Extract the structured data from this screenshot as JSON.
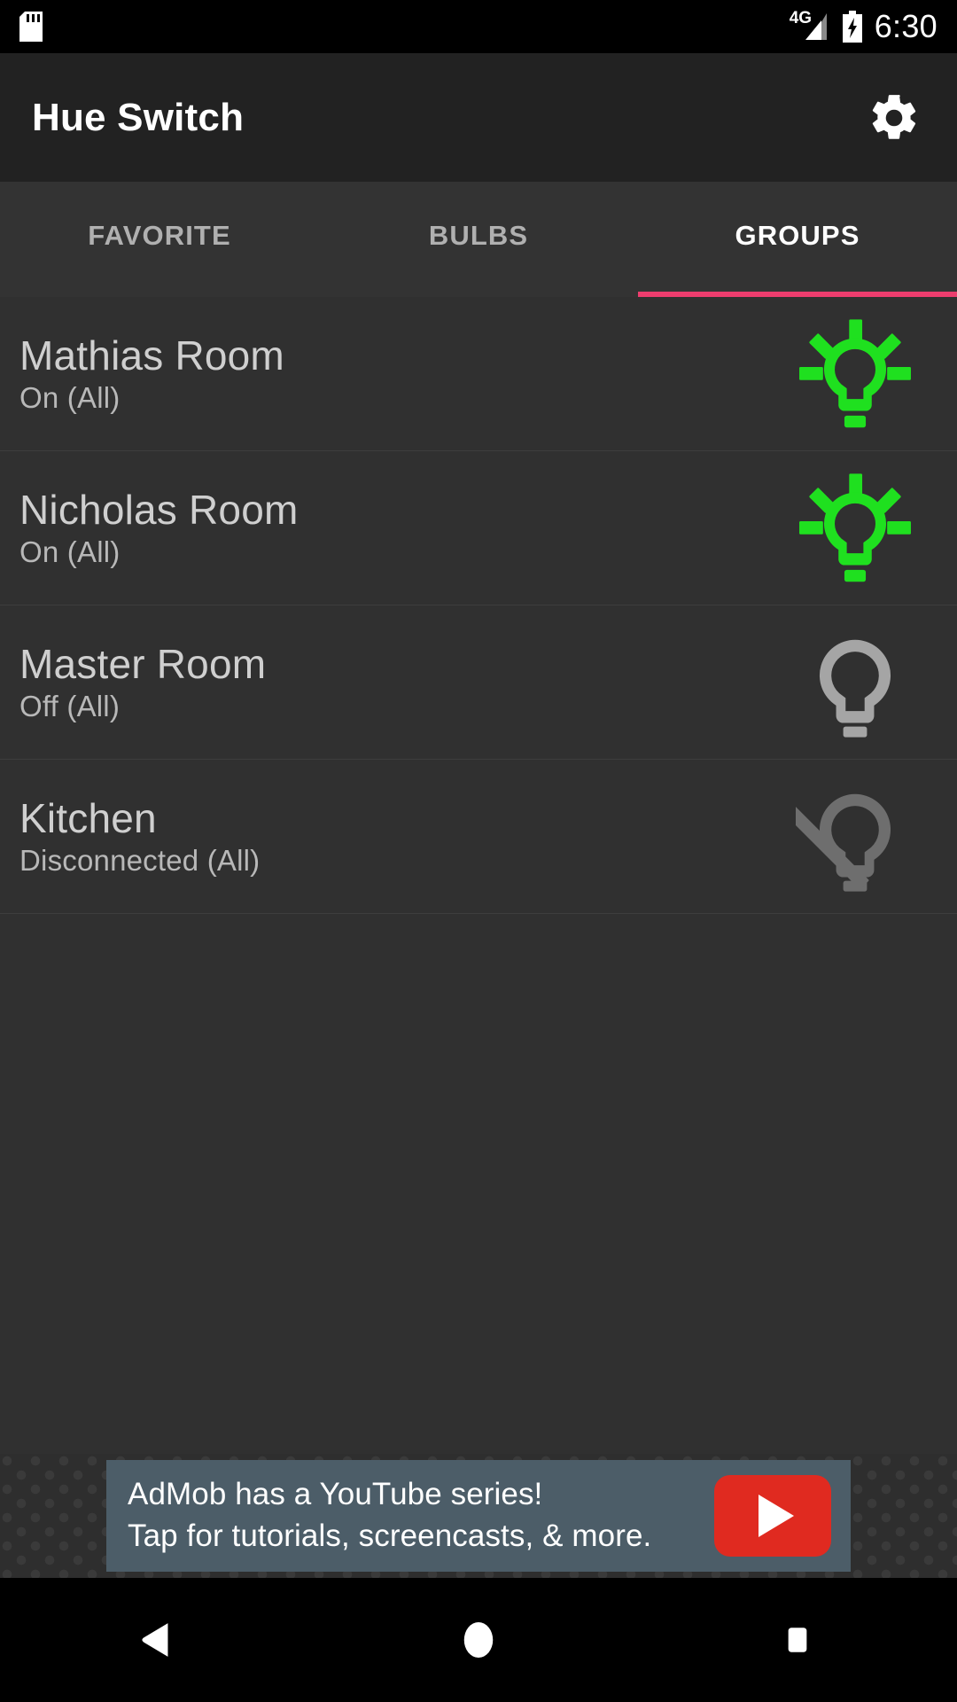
{
  "statusbar": {
    "sd_icon": "sd-card-icon",
    "network_label": "4G",
    "signal_icon": "signal-bars-icon",
    "battery_icon": "battery-charging-icon",
    "time": "6:30"
  },
  "toolbar": {
    "title": "Hue Switch",
    "settings_icon": "gear-icon"
  },
  "tabs": {
    "items": [
      {
        "label": "FAVORITE",
        "active": false
      },
      {
        "label": "BULBS",
        "active": false
      },
      {
        "label": "GROUPS",
        "active": true
      }
    ],
    "indicator_color": "#ED3D6E",
    "active_index": 2
  },
  "groups": {
    "rows": [
      {
        "name": "Mathias Room",
        "status": "On (All)",
        "icon": "bulb-on-icon",
        "icon_color": "#1FE01F"
      },
      {
        "name": "Nicholas Room",
        "status": "On (All)",
        "icon": "bulb-on-icon",
        "icon_color": "#1FE01F"
      },
      {
        "name": "Master Room",
        "status": "Off (All)",
        "icon": "bulb-off-icon",
        "icon_color": "#A5A5A5"
      },
      {
        "name": "Kitchen",
        "status": "Disconnected (All)",
        "icon": "bulb-disconnected-icon",
        "icon_color": "#6E6E6E"
      }
    ]
  },
  "ad": {
    "line1": "AdMob has a YouTube series!",
    "line2": "Tap for tutorials, screencasts, & more.",
    "play_icon": "youtube-play-icon",
    "background_color": "#4C5D68",
    "play_button_color": "#E02A20"
  },
  "navbar": {
    "back_icon": "back-triangle-icon",
    "home_icon": "home-circle-icon",
    "recents_icon": "recents-square-icon"
  }
}
